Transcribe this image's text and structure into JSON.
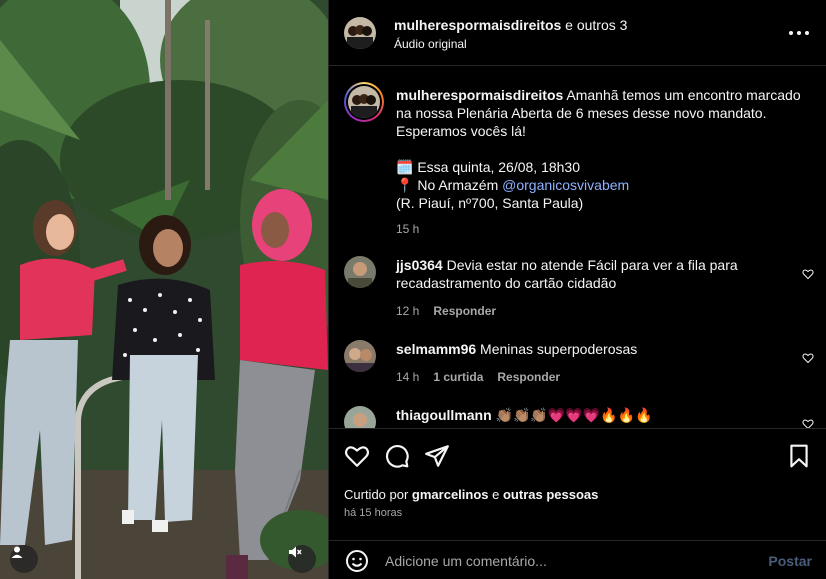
{
  "header": {
    "username": "mulherespormaisdireitos",
    "others": " e outros 3",
    "audio": "Áudio original",
    "more_icon": "more-horizontal-icon"
  },
  "caption": {
    "username": "mulherespormaisdireitos",
    "text1": " Amanhã temos um encontro marcado na nossa Plenária Aberta de 6 meses desse novo mandato. Esperamos vocês lá!",
    "date_emoji": "🗓️",
    "date_text": " Essa quinta, 26/08, 18h30",
    "pin_emoji": "📍",
    "place_text": " No Armazém ",
    "place_link": "@organicosvivabem",
    "address": "(R. Piauí, nº700, Santa Paula)",
    "time": "15 h"
  },
  "comments": [
    {
      "username": "jjs0364",
      "text": " Devia estar no atende Fácil para ver a fila para recadastramento do cartão cidadão",
      "time": "12 h",
      "likes": "",
      "reply": "Responder"
    },
    {
      "username": "selmamm96",
      "text": " Meninas superpoderosas",
      "time": "14 h",
      "likes": "1 curtida",
      "reply": "Responder"
    },
    {
      "username": "thiagoullmann",
      "text": " 👏🏽👏🏽👏🏽💗💗💗🔥🔥🔥",
      "time": "",
      "likes": "",
      "reply": ""
    }
  ],
  "actions": {
    "liked_prefix": "Curtido por ",
    "liked_user": "gmarcelinos",
    "liked_mid": " e ",
    "liked_others": "outras pessoas",
    "ago": "há 15 horas"
  },
  "compose": {
    "placeholder": "Adicione um comentário...",
    "post_label": "Postar"
  },
  "colors": {
    "link": "#8fb2ff",
    "post_disabled": "#4a5d7a",
    "muted": "#a8a8a8"
  }
}
